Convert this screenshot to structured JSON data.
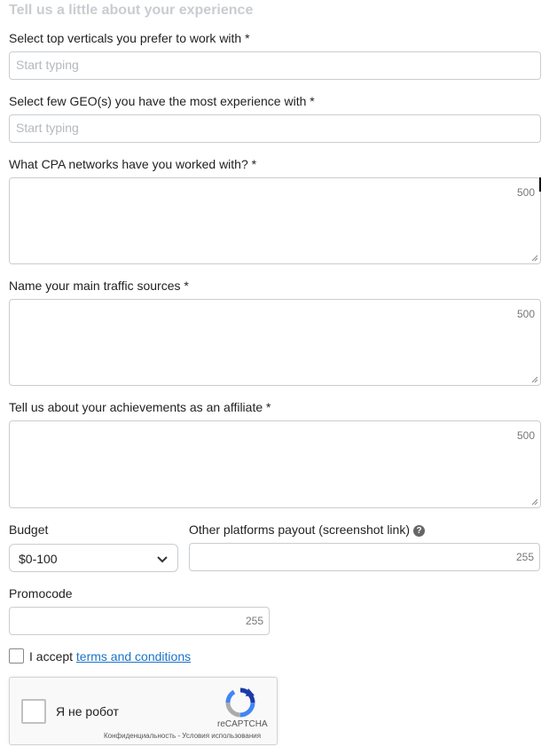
{
  "form": {
    "heading": "Tell us a little about your experience",
    "verticals": {
      "label": "Select top verticals you prefer to work with *",
      "placeholder": "Start typing"
    },
    "geos": {
      "label": "Select few GEO(s) you have the most experience with *",
      "placeholder": "Start typing"
    },
    "cpa_networks": {
      "label": "What CPA networks have you worked with? *",
      "counter": "500"
    },
    "traffic_sources": {
      "label": "Name your main traffic sources *",
      "counter": "500"
    },
    "achievements": {
      "label": "Tell us about your achievements as an affiliate *",
      "counter": "500"
    },
    "budget": {
      "label": "Budget",
      "value": "$0-100"
    },
    "payout": {
      "label": "Other platforms payout (screenshot link)",
      "help_icon": "?",
      "counter": "255"
    },
    "promocode": {
      "label": "Promocode",
      "counter": "255"
    },
    "terms": {
      "prefix": "I accept ",
      "link_text": "terms and conditions",
      "checked": false
    }
  },
  "captcha": {
    "label": "Я не робот",
    "brand": "reCAPTCHA",
    "privacy": "Конфиденциальность",
    "separator": " - ",
    "terms": "Условия использования"
  },
  "icons": {
    "chevron": "chevron-down-icon",
    "help": "question-circle-icon",
    "resize": "resize-grip-icon",
    "recaptcha": "recaptcha-logo-icon"
  },
  "colors": {
    "heading": "#c9cdd1",
    "link": "#1a73c8",
    "border": "#c9cdd1",
    "placeholder": "#b5b9bd"
  }
}
